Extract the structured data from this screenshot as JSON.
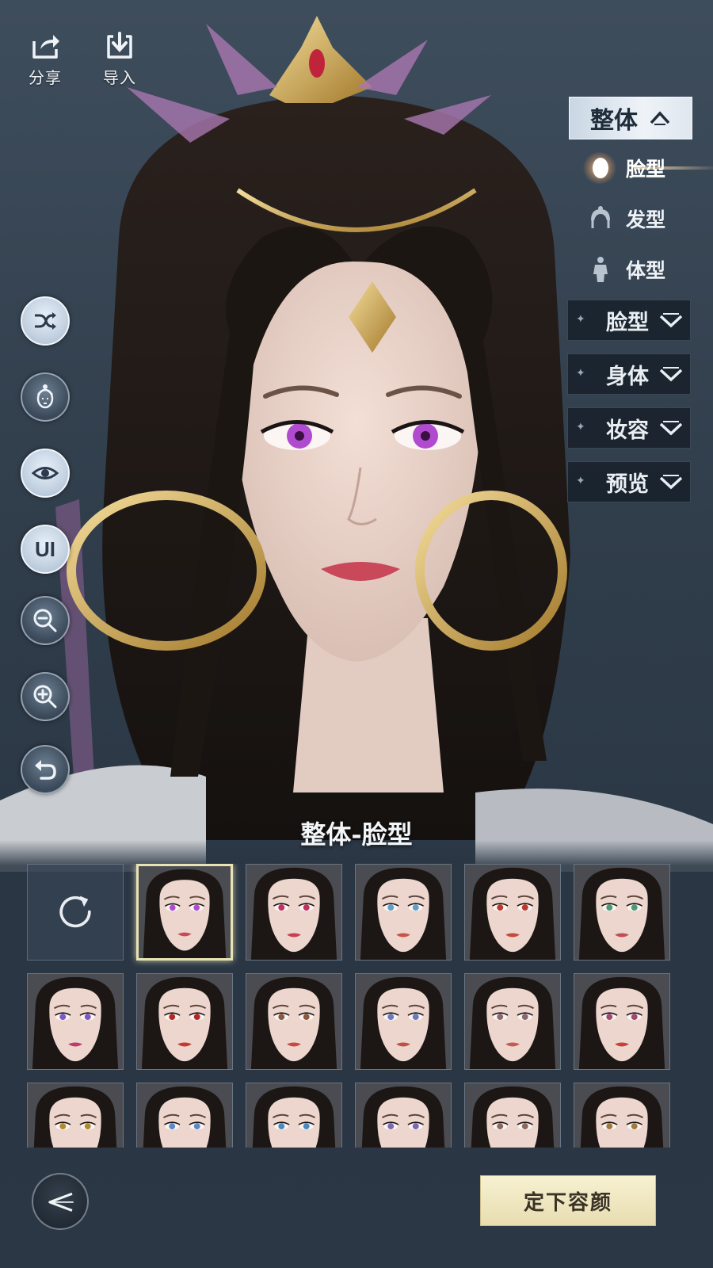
{
  "top_actions": {
    "share_label": "分享",
    "import_label": "导入"
  },
  "left_tools": [
    {
      "name": "shuffle-icon"
    },
    {
      "name": "face-icon"
    },
    {
      "name": "eye-icon"
    },
    {
      "name": "ui-toggle",
      "label": "UI"
    },
    {
      "name": "zoom-out-icon"
    },
    {
      "name": "zoom-in-icon"
    },
    {
      "name": "undo-icon"
    }
  ],
  "right_panel": {
    "header": {
      "label": "整体"
    },
    "sub_items": [
      {
        "label": "脸型",
        "icon": "face-shape-icon",
        "active": true
      },
      {
        "label": "发型",
        "icon": "hairstyle-icon",
        "active": false
      },
      {
        "label": "体型",
        "icon": "body-type-icon",
        "active": false
      }
    ],
    "categories": [
      {
        "label": "脸型"
      },
      {
        "label": "身体"
      },
      {
        "label": "妆容"
      },
      {
        "label": "预览"
      }
    ]
  },
  "preset_panel": {
    "title": "整体-脸型",
    "selected_index": 0,
    "presets": [
      {
        "eye": "#b04bd0",
        "lip": "#c9485a"
      },
      {
        "eye": "#c03060",
        "lip": "#c84050"
      },
      {
        "eye": "#5fa0c8",
        "lip": "#c8554a"
      },
      {
        "eye": "#b83a2f",
        "lip": "#c44a3a"
      },
      {
        "eye": "#4a9a78",
        "lip": "#c05050"
      },
      {
        "eye": "#7b5ac8",
        "lip": "#c03a6a"
      },
      {
        "eye": "#b02a2a",
        "lip": "#c43a30"
      },
      {
        "eye": "#8a5a40",
        "lip": "#c84a40"
      },
      {
        "eye": "#6a7ac0",
        "lip": "#c05048"
      },
      {
        "eye": "#8a6a70",
        "lip": "#c45a55"
      },
      {
        "eye": "#a04a70",
        "lip": "#c8403a"
      },
      {
        "eye": "#b08a30",
        "lip": "#c85a50"
      },
      {
        "eye": "#5a8ac8",
        "lip": "#c85a50"
      },
      {
        "eye": "#4a8ac0",
        "lip": "#c85050"
      },
      {
        "eye": "#7a6ab0",
        "lip": "#c06060"
      },
      {
        "eye": "#8a6a60",
        "lip": "#c45a55"
      },
      {
        "eye": "#a07a40",
        "lip": "#c05a50"
      }
    ]
  },
  "confirm_label": "定下容颜",
  "colors": {
    "accent": "#e8ddb0",
    "panel": "#2b3745",
    "selected_border": "#e7e3b4"
  }
}
